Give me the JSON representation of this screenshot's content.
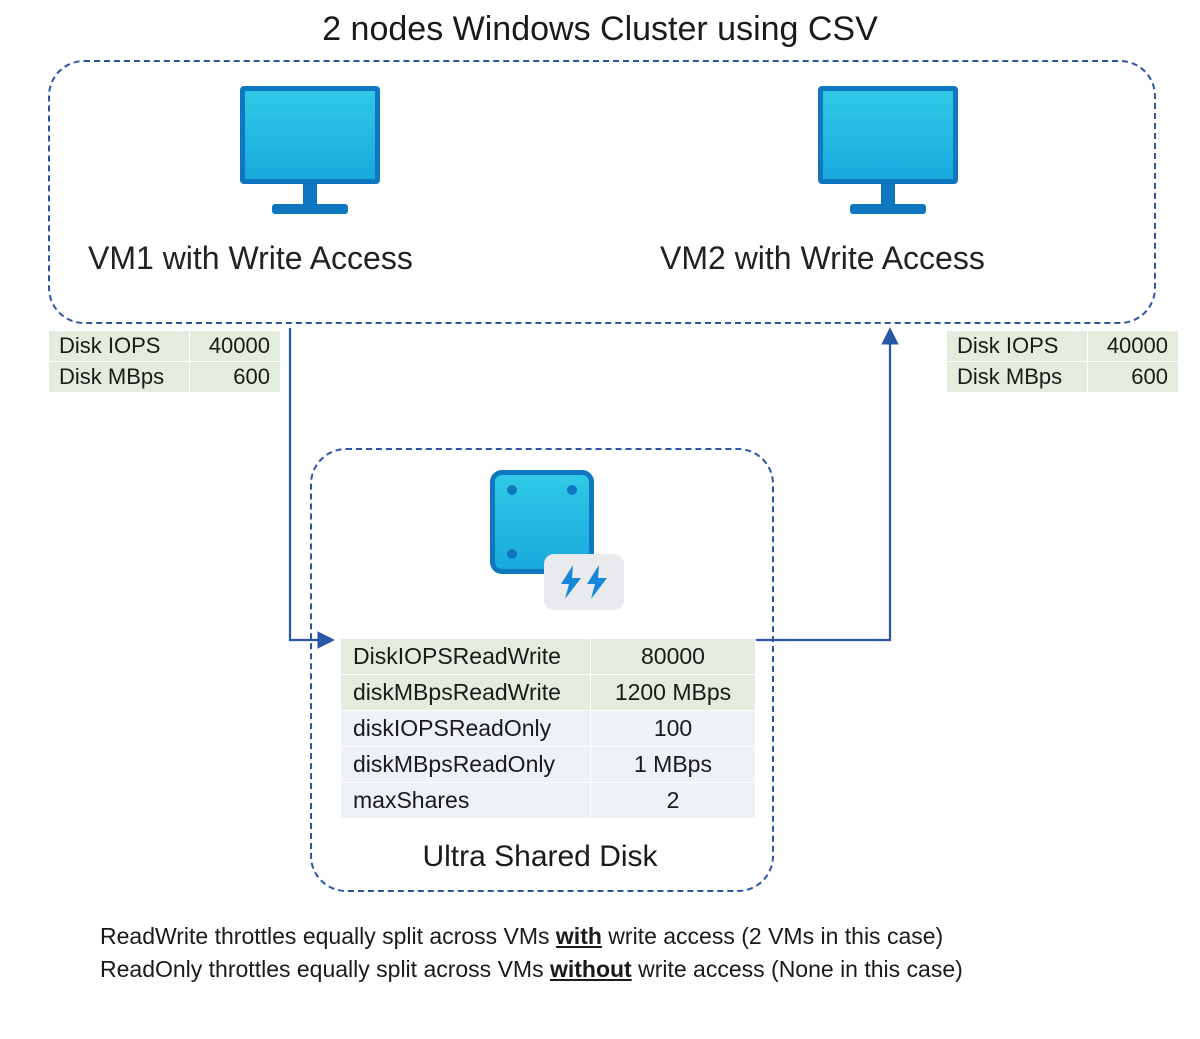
{
  "title": "2 nodes Windows Cluster using CSV",
  "vm1": {
    "label": "VM1 with Write Access",
    "iops_label": "Disk IOPS",
    "iops_value": "40000",
    "mbps_label": "Disk MBps",
    "mbps_value": "600"
  },
  "vm2": {
    "label": "VM2 with Write Access",
    "iops_label": "Disk IOPS",
    "iops_value": "40000",
    "mbps_label": "Disk MBps",
    "mbps_value": "600"
  },
  "disk": {
    "label": "Ultra Shared Disk",
    "rows": [
      {
        "key": "DiskIOPSReadWrite",
        "value": "80000",
        "class": "rw"
      },
      {
        "key": "diskMBpsReadWrite",
        "value": "1200 MBps",
        "class": "rw"
      },
      {
        "key": "diskIOPSReadOnly",
        "value": "100",
        "class": "ro"
      },
      {
        "key": "diskMBpsReadOnly",
        "value": "1 MBps",
        "class": "ro"
      },
      {
        "key": "maxShares",
        "value": "2",
        "class": "ro"
      }
    ]
  },
  "notes": {
    "line1_a": "ReadWrite throttles equally split across VMs ",
    "line1_b": "with",
    "line1_c": " write access (2 VMs in this case)",
    "line2_a": "ReadOnly throttles equally split across VMs ",
    "line2_b": "without",
    "line2_c": " write access (None in this case)"
  }
}
